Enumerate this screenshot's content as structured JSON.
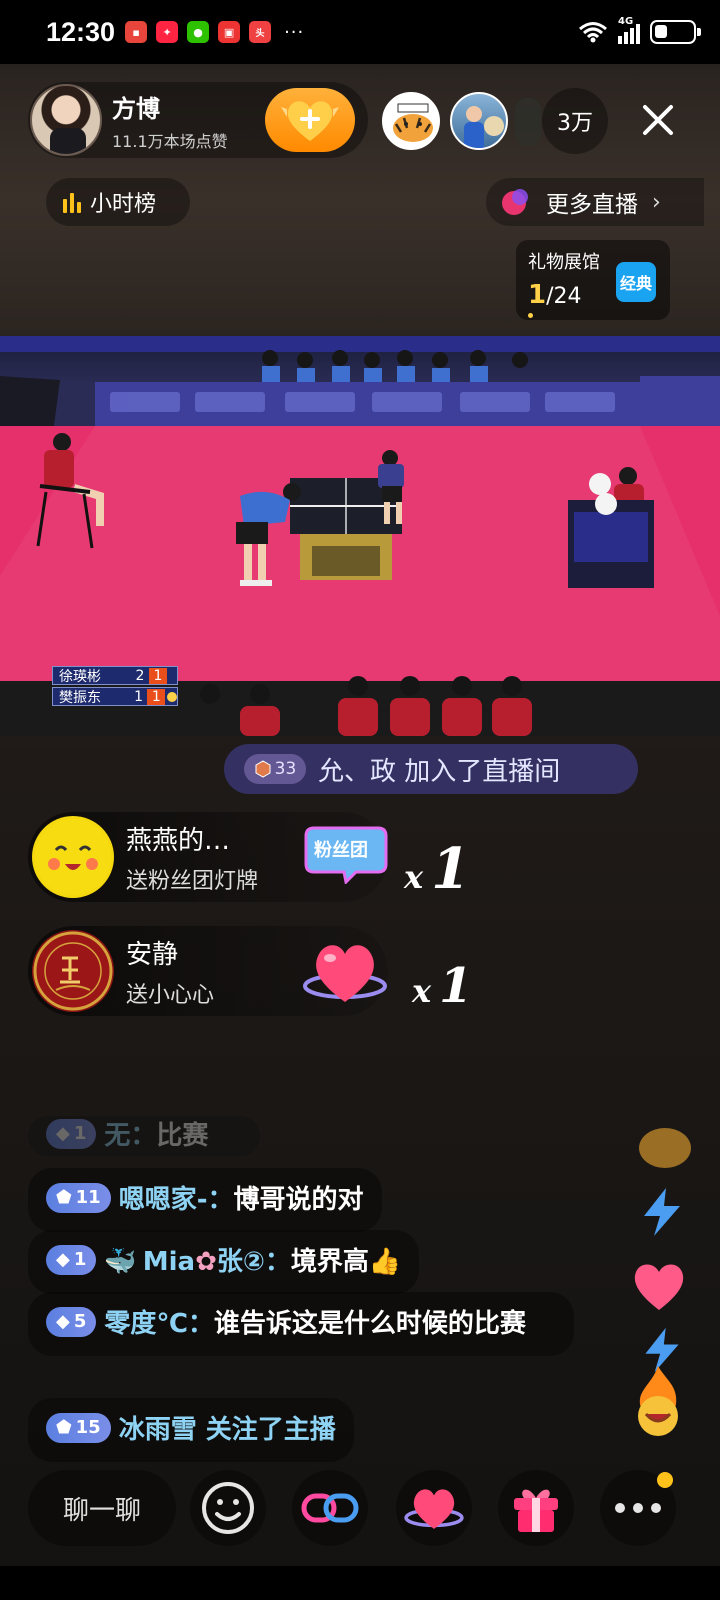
{
  "status_bar": {
    "time": "12:30",
    "notification_icons": [
      "toutiao-news-icon",
      "xiaohongshu-icon",
      "wechat-icon",
      "gift-app-icon",
      "toutiao-icon"
    ],
    "more": "···",
    "network": "4G"
  },
  "host": {
    "name": "方博",
    "likes": "11.1万本场点赞"
  },
  "viewers": {
    "count": "3万"
  },
  "rank": {
    "label": "小时榜"
  },
  "more_live": {
    "label": "更多直播"
  },
  "gift_hall": {
    "title": "礼物展馆",
    "current": "1",
    "total": "/24",
    "badge": "经典"
  },
  "scoreboard": {
    "rows": [
      {
        "player": "徐瑛彬",
        "sets": "2",
        "points": "1"
      },
      {
        "player": "樊振东",
        "sets": "1",
        "points": "1"
      }
    ]
  },
  "join_banner": {
    "level": "33",
    "text": "允、政 加入了直播间"
  },
  "gifts": [
    {
      "user": "燕燕的…",
      "action": "送粉丝团灯牌",
      "badge": "粉丝团",
      "x": "x",
      "count": "1"
    },
    {
      "user": "安静",
      "action": "送小心心",
      "x": "x",
      "count": "1"
    }
  ],
  "chat": {
    "faded": {
      "level": "1",
      "name": "无：",
      "text": "比赛"
    },
    "messages": [
      {
        "level": "11",
        "name": "嗯嗯家-：",
        "text": "博哥说的对"
      },
      {
        "level": "1",
        "name": "Mia",
        "name_rest": "张②：",
        "text": "境界高"
      },
      {
        "level": "5",
        "name": "零度℃：",
        "text": "谁告诉这是什么时候的比赛"
      },
      {
        "level": "15",
        "name": "冰雨雪",
        "text": " 关注了主播"
      }
    ]
  },
  "bottom_bar": {
    "chat_placeholder": "聊一聊"
  },
  "colors": {
    "accent_orange": "#ff9a1a",
    "chat_name": "#8fd3f4",
    "court_pink": "#e5306b",
    "gold": "#ffd048"
  }
}
